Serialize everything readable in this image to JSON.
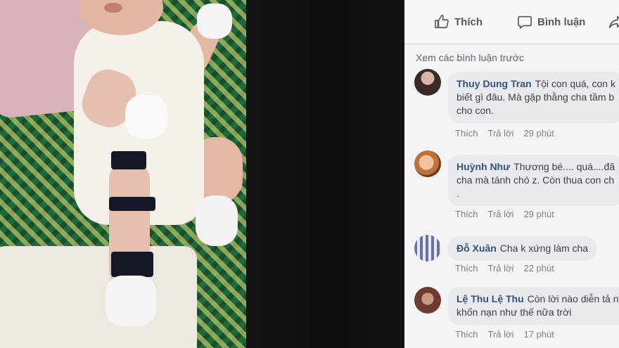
{
  "actions": {
    "like_label": "Thích",
    "comment_label": "Bình luận"
  },
  "see_previous": "Xem các bình luận trước",
  "comments": [
    {
      "author": "Thuy Dung Tran",
      "lines": [
        "Tội con quá, con k",
        "biết gì đâu. Mà gặp thằng cha tầm b",
        "cho con."
      ],
      "like": "Thích",
      "reply": "Trả lời",
      "time": "29 phút"
    },
    {
      "author": "Huỳnh Như",
      "lines": [
        "Thương bé.... quá....đã",
        "cha mà tánh chó z. Còn thua con ch",
        "."
      ],
      "like": "Thích",
      "reply": "Trả lời",
      "time": "29 phút"
    },
    {
      "author": "Đỗ Xuân",
      "lines": [
        "Cha k xứng làm cha"
      ],
      "like": "Thích",
      "reply": "Trả lời",
      "time": "22 phút"
    },
    {
      "author": "Lệ Thu Lệ Thu",
      "lines": [
        "Còn lời nào diễn tả n",
        "khốn nạn như thế nữa trời"
      ],
      "like": "Thích",
      "reply": "Trả lời",
      "time": "17 phút"
    }
  ],
  "colors": {
    "author": "#33507e",
    "bubble": "#e8eaed",
    "panel": "#f3f4f6"
  }
}
